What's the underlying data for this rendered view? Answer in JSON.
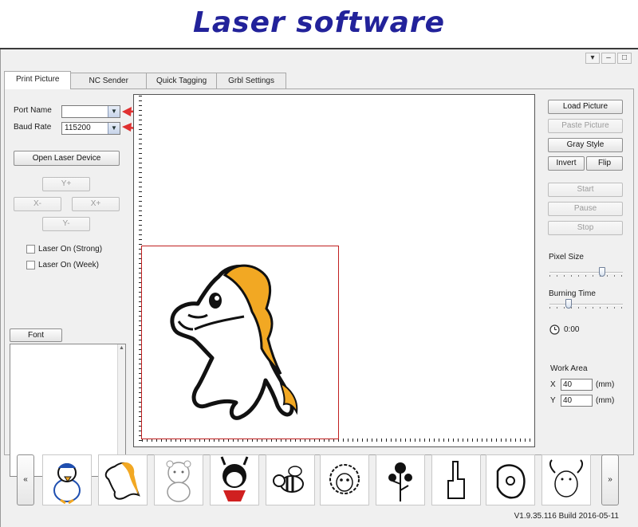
{
  "banner": {
    "title": "Laser software"
  },
  "window": {
    "controls": [
      "▾",
      "–",
      "□"
    ],
    "tabs": [
      "Print Picture",
      "NC Sender",
      "Quick Tagging",
      "Grbl Settings"
    ]
  },
  "left": {
    "port_name_label": "Port Name",
    "port_name_value": "",
    "baud_rate_label": "Baud Rate",
    "baud_rate_value": "115200",
    "open_device": "Open Laser Device",
    "jog": {
      "y_plus": "Y+",
      "x_minus": "X-",
      "x_plus": "X+",
      "y_minus": "Y-"
    },
    "laser_strong": "Laser On (Strong)",
    "laser_week": "Laser On (Week)",
    "font_button": "Font"
  },
  "right": {
    "load_picture": "Load Picture",
    "paste_picture": "Paste Picture",
    "gray_style": "Gray Style",
    "invert": "Invert",
    "flip": "Flip",
    "start": "Start",
    "pause": "Pause",
    "stop": "Stop",
    "pixel_size_label": "Pixel Size",
    "pixel_size_level": 0.72,
    "burning_time_label": "Burning Time",
    "burning_time_level": 0.26,
    "timer": "0:00",
    "work_area_label": "Work Area",
    "x_label": "X",
    "x_value": "40",
    "y_label": "Y",
    "y_value": "40",
    "unit": "(mm)"
  },
  "gallery": {
    "prev": "«",
    "next": "»",
    "items": [
      "duck-icon",
      "pony-icon",
      "bear-icon",
      "panda-girl-icon",
      "bee-icon",
      "sheep-icon",
      "rose-icon",
      "hand-gesture-icon",
      "pointing-hand-icon",
      "bull-icon"
    ]
  },
  "footer": {
    "build": "V1.9.35.116 Build 2016-05-11"
  },
  "colors": {
    "banner_text": "#22229a",
    "annotation_arrow": "#e03030",
    "work_area": "#c02020",
    "horse_mane": "#f2a823"
  }
}
